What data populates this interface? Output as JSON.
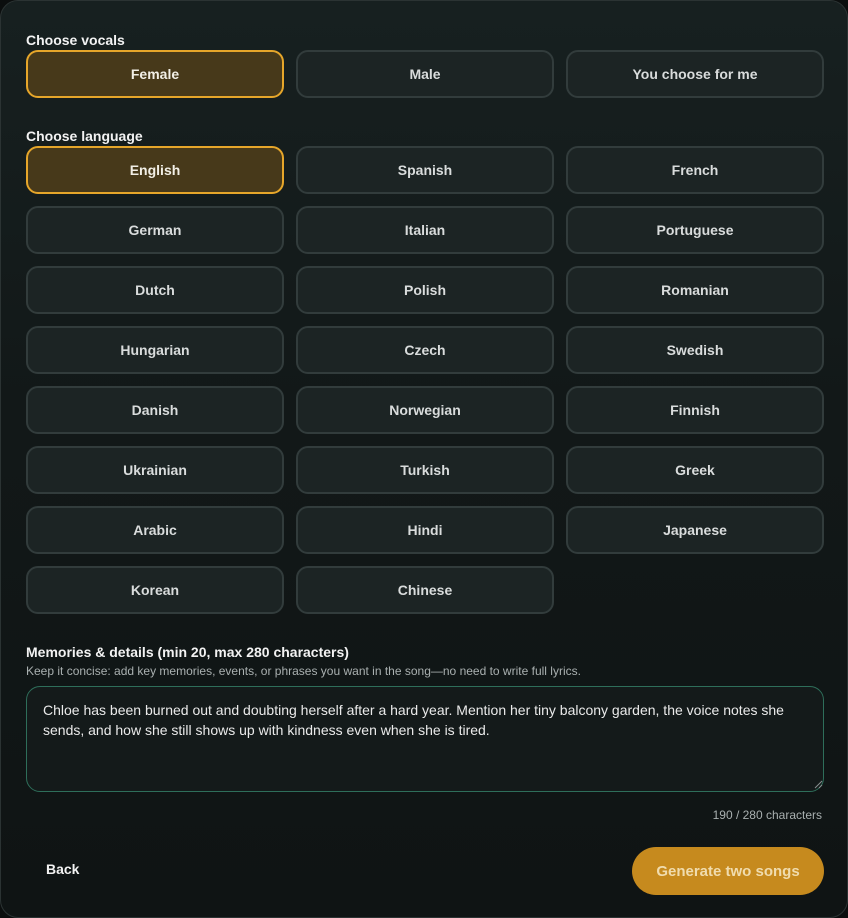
{
  "vocals": {
    "label": "Choose vocals",
    "options": [
      "Female",
      "Male",
      "You choose for me"
    ],
    "selected": "Female"
  },
  "language": {
    "label": "Choose language",
    "options": [
      "English",
      "Spanish",
      "French",
      "German",
      "Italian",
      "Portuguese",
      "Dutch",
      "Polish",
      "Romanian",
      "Hungarian",
      "Czech",
      "Swedish",
      "Danish",
      "Norwegian",
      "Finnish",
      "Ukrainian",
      "Turkish",
      "Greek",
      "Arabic",
      "Hindi",
      "Japanese",
      "Korean",
      "Chinese"
    ],
    "selected": "English"
  },
  "memories": {
    "label": "Memories & details (min 20, max 280 characters)",
    "hint": "Keep it concise: add key memories, events, or phrases you want in the song—no need to write full lyrics.",
    "value": "Chloe has been burned out and doubting herself after a hard year. Mention her tiny balcony garden, the voice notes she sends, and how she still shows up with kindness even when she is tired.",
    "counter": "190 / 280 characters"
  },
  "actions": {
    "back_label": "Back",
    "generate_label": "Generate two songs"
  },
  "colors": {
    "accent": "#e6a62a",
    "selected_bg": "#47391a",
    "button_bg": "#c68a1e",
    "textarea_border": "#2e6e5a"
  }
}
